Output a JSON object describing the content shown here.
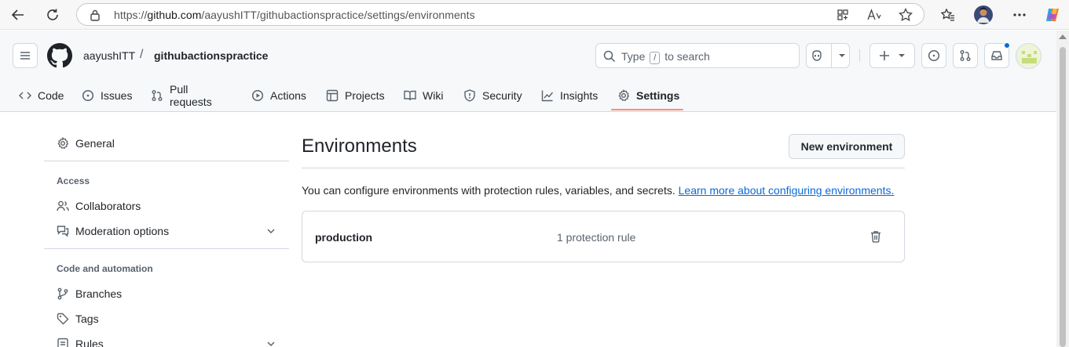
{
  "browser": {
    "url_prefix": "https://",
    "url_host": "github.com",
    "url_path": "/aayushITT/githubactionspractice/settings/environments"
  },
  "header": {
    "owner": "aayushITT",
    "separator": "/",
    "repo": "githubactionspractice",
    "search_pre": "Type",
    "search_key": "/",
    "search_post": "to search"
  },
  "tabs": [
    {
      "label": "Code",
      "icon": "code-icon"
    },
    {
      "label": "Issues",
      "icon": "issue-icon"
    },
    {
      "label": "Pull requests",
      "icon": "pull-request-icon"
    },
    {
      "label": "Actions",
      "icon": "play-icon"
    },
    {
      "label": "Projects",
      "icon": "table-icon"
    },
    {
      "label": "Wiki",
      "icon": "book-icon"
    },
    {
      "label": "Security",
      "icon": "shield-icon"
    },
    {
      "label": "Insights",
      "icon": "graph-icon"
    },
    {
      "label": "Settings",
      "icon": "gear-icon",
      "active": true
    }
  ],
  "sidebar": {
    "general": "General",
    "access_heading": "Access",
    "collaborators": "Collaborators",
    "moderation": "Moderation options",
    "code_heading": "Code and automation",
    "branches": "Branches",
    "tags": "Tags",
    "rules": "Rules"
  },
  "main": {
    "title": "Environments",
    "new_button": "New environment",
    "description": "You can configure environments with protection rules, variables, and secrets.",
    "learn_link": "Learn more about configuring environments.",
    "environments": [
      {
        "name": "production",
        "rules": "1 protection rule"
      }
    ]
  },
  "colors": {
    "accent_link": "#0969da",
    "active_tab_underline": "#fd8c73",
    "border": "#d1d9e0"
  }
}
